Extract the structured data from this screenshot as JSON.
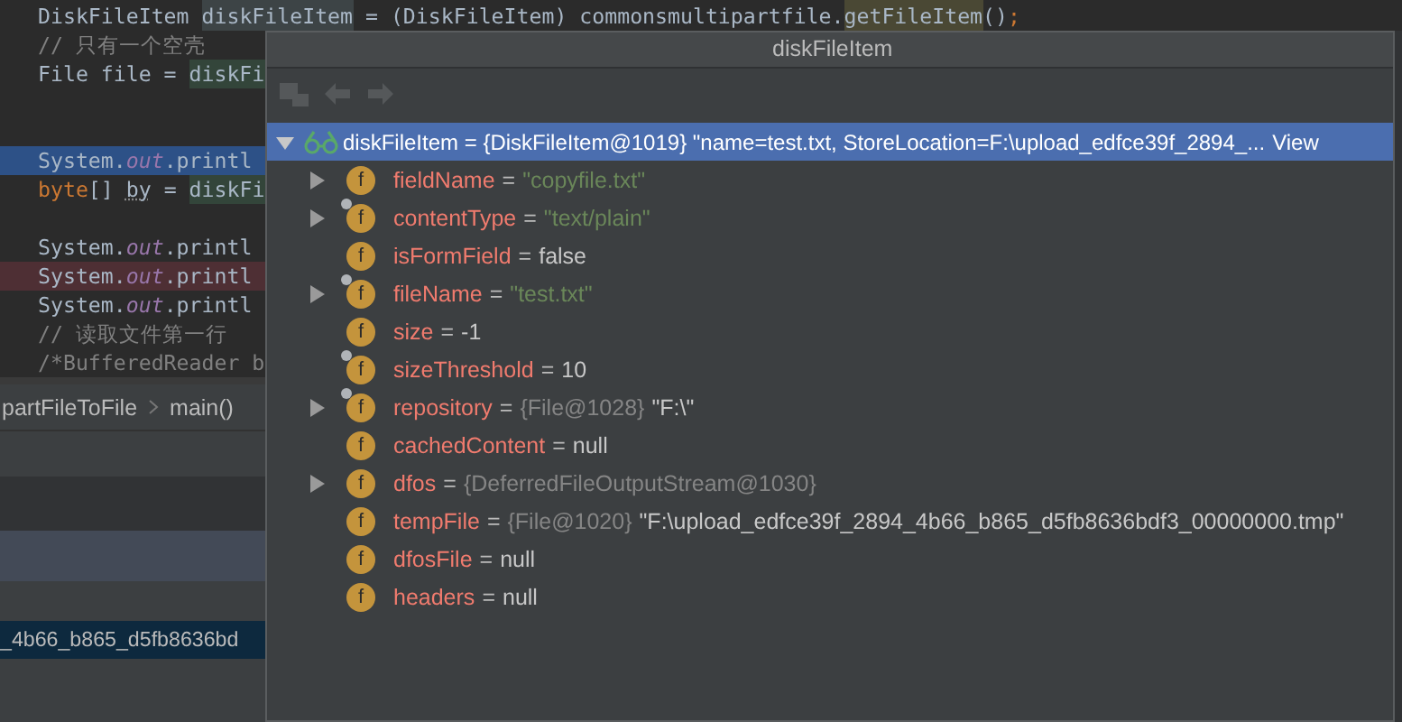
{
  "editor": {
    "first_line": {
      "tokens": [
        {
          "text": "DiskFileItem ",
          "kind": "plain"
        },
        {
          "text": "diskFileItem",
          "kind": "usage"
        },
        {
          "text": " = (DiskFileItem) commonsmultipartfile.",
          "kind": "plain"
        },
        {
          "text": "getFileItem",
          "kind": "call"
        },
        {
          "text": "()",
          "kind": "plain"
        },
        {
          "text": ";",
          "kind": "keyword"
        }
      ]
    },
    "lines": [
      {
        "kind": "normal",
        "tokens": [
          {
            "text": "// 只有一个空壳",
            "kind": "comment"
          }
        ]
      },
      {
        "kind": "normal",
        "tokens": [
          {
            "text": "File file = ",
            "kind": "plain"
          },
          {
            "text": "diskFi",
            "kind": "ref"
          }
        ]
      },
      {
        "kind": "normal"
      },
      {
        "kind": "normal"
      },
      {
        "kind": "current",
        "tokens": [
          {
            "text": "System.",
            "kind": "plain"
          },
          {
            "text": "out",
            "kind": "field"
          },
          {
            "text": ".printl",
            "kind": "plain"
          }
        ]
      },
      {
        "kind": "normal",
        "tokens": [
          {
            "text": "byte",
            "kind": "keyword"
          },
          {
            "text": "[] ",
            "kind": "plain"
          },
          {
            "text": "by",
            "kind": "unused"
          },
          {
            "text": " = ",
            "kind": "plain"
          },
          {
            "text": "diskFi",
            "kind": "ref"
          }
        ]
      },
      {
        "kind": "normal"
      },
      {
        "kind": "normal",
        "tokens": [
          {
            "text": "System.",
            "kind": "plain"
          },
          {
            "text": "out",
            "kind": "field"
          },
          {
            "text": ".printl",
            "kind": "plain"
          }
        ]
      },
      {
        "kind": "breakpoint",
        "tokens": [
          {
            "text": "System.",
            "kind": "plain"
          },
          {
            "text": "out",
            "kind": "field"
          },
          {
            "text": ".printl",
            "kind": "plain"
          }
        ]
      },
      {
        "kind": "normal",
        "tokens": [
          {
            "text": "System.",
            "kind": "plain"
          },
          {
            "text": "out",
            "kind": "field"
          },
          {
            "text": ".printl",
            "kind": "plain"
          }
        ]
      },
      {
        "kind": "normal",
        "tokens": [
          {
            "text": "// 读取文件第一行",
            "kind": "comment"
          }
        ]
      },
      {
        "kind": "normal",
        "tokens": [
          {
            "text": "/*BufferedReader b",
            "kind": "comment"
          }
        ]
      }
    ]
  },
  "breadcrumb": [
    {
      "label": "partFileToFile"
    },
    {
      "label": "main()"
    }
  ],
  "output_row": {
    "text": "_4b66_b865_d5fb8636bd"
  },
  "popup": {
    "title": "diskFileItem",
    "toolbar": [
      {
        "kind": "tree",
        "disabled": true
      },
      {
        "kind": "back",
        "disabled": true
      },
      {
        "kind": "forward",
        "disabled": true
      }
    ],
    "root": {
      "name": "diskFileItem",
      "operator": "=",
      "ref": "{DiskFileItem@1019}",
      "value": "\"name=test.txt, StoreLocation=F:\\upload_edfce39f_2894_...",
      "link": "View",
      "expanded": true,
      "selected": true,
      "children": [
        {
          "icon": "f",
          "name": "fieldName",
          "operator": "=",
          "value": {
            "text": "\"copyfile.txt\"",
            "kind": "string"
          },
          "expandable": true,
          "final": false
        },
        {
          "icon": "f",
          "name": "contentType",
          "operator": "=",
          "value": {
            "text": "\"text/plain\"",
            "kind": "string"
          },
          "expandable": true,
          "final": true
        },
        {
          "icon": "f",
          "name": "isFormField",
          "operator": "=",
          "value": {
            "text": "false",
            "kind": "literal"
          },
          "expandable": false,
          "final": false
        },
        {
          "icon": "f",
          "name": "fileName",
          "operator": "=",
          "value": {
            "text": "\"test.txt\"",
            "kind": "string"
          },
          "expandable": true,
          "final": true
        },
        {
          "icon": "f",
          "name": "size",
          "operator": "=",
          "value": {
            "text": "-1",
            "kind": "literal"
          },
          "expandable": false,
          "final": false
        },
        {
          "icon": "f",
          "name": "sizeThreshold",
          "operator": "=",
          "value": {
            "text": "10",
            "kind": "literal"
          },
          "expandable": false,
          "final": true
        },
        {
          "icon": "f",
          "name": "repository",
          "operator": "=",
          "ref": "{File@1028}",
          "value": {
            "text": "\"F:\\\"",
            "kind": "literal"
          },
          "expandable": true,
          "final": true
        },
        {
          "icon": "f",
          "name": "cachedContent",
          "operator": "=",
          "value": {
            "text": "null",
            "kind": "literal"
          },
          "expandable": false,
          "final": false
        },
        {
          "icon": "f",
          "name": "dfos",
          "operator": "=",
          "ref": "{DeferredFileOutputStream@1030}",
          "expandable": true,
          "final": false
        },
        {
          "icon": "f",
          "name": "tempFile",
          "operator": "=",
          "ref": "{File@1020}",
          "value": {
            "text": "\"F:\\upload_edfce39f_2894_4b66_b865_d5fb8636bdf3_00000000.tmp\"",
            "kind": "literal"
          },
          "expandable": false,
          "final": false
        },
        {
          "icon": "f",
          "name": "dfosFile",
          "operator": "=",
          "value": {
            "text": "null",
            "kind": "literal"
          },
          "expandable": false,
          "final": false
        },
        {
          "icon": "f",
          "name": "headers",
          "operator": "=",
          "value": {
            "text": "null",
            "kind": "literal"
          },
          "expandable": false,
          "final": false
        }
      ]
    }
  }
}
